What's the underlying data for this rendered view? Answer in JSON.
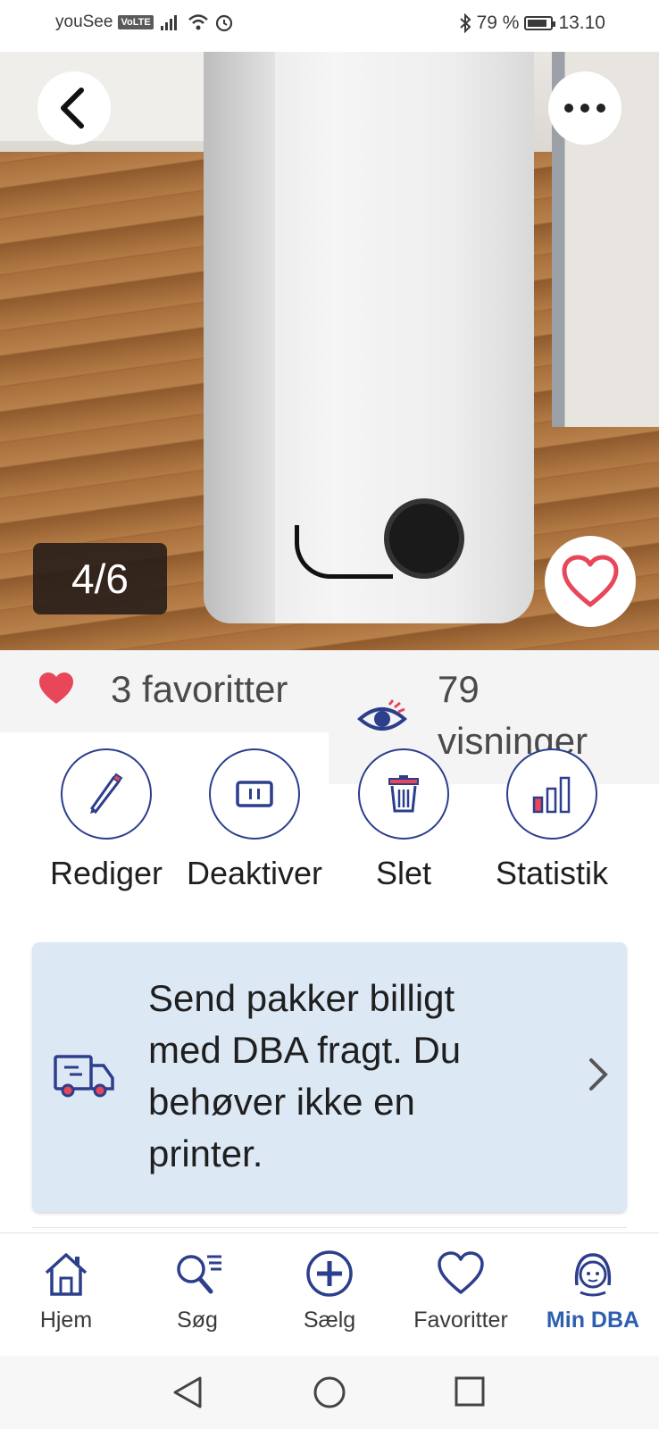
{
  "status_bar": {
    "carrier": "youSee",
    "volte": "VoLTE",
    "battery": "79 %",
    "time": "13.10"
  },
  "gallery": {
    "counter": "4/6"
  },
  "stats": {
    "favorites": "3 favoritter",
    "views_count": "79",
    "views_label": "visninger"
  },
  "actions": [
    {
      "label": "Rediger",
      "icon": "pencil-icon"
    },
    {
      "label": "Deaktiver",
      "icon": "pause-icon"
    },
    {
      "label": "Slet",
      "icon": "trash-icon"
    },
    {
      "label": "Statistik",
      "icon": "bar-chart-icon"
    }
  ],
  "shipping_card": {
    "text": "Send pakker billigt med DBA fragt. Du behøver ikke en printer.",
    "icon": "truck-icon"
  },
  "bottom_nav": [
    {
      "label": "Hjem",
      "icon": "home-icon"
    },
    {
      "label": "Søg",
      "icon": "search-icon"
    },
    {
      "label": "Sælg",
      "icon": "plus-circle-icon"
    },
    {
      "label": "Favoritter",
      "icon": "heart-icon"
    },
    {
      "label": "Min DBA",
      "icon": "profile-icon",
      "active": true
    }
  ],
  "colors": {
    "brand_blue": "#2c3e8c",
    "active_blue": "#2c5fb0",
    "heart_red": "#e8475a",
    "card_bg": "#dde8f5"
  }
}
